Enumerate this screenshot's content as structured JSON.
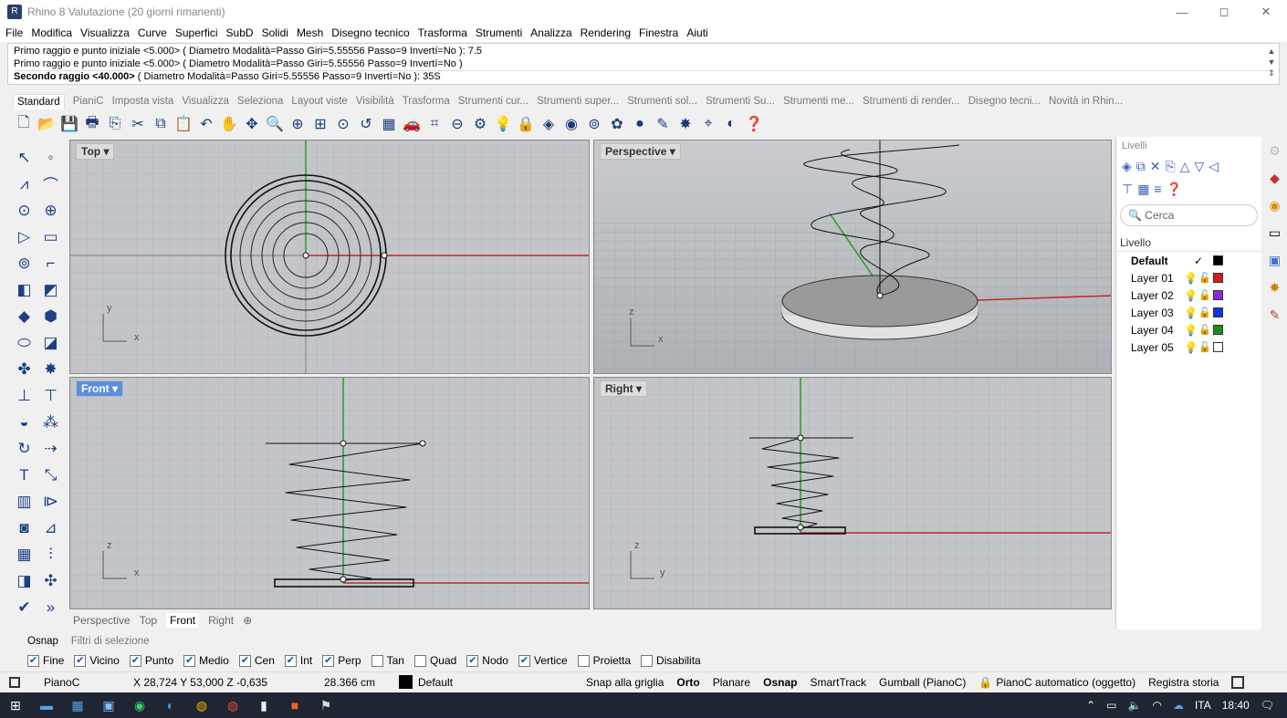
{
  "window": {
    "title": "Rhino 8 Valutazione (20 giorni rimanenti)",
    "min": "—",
    "max": "◻",
    "close": "✕"
  },
  "menu": [
    "File",
    "Modifica",
    "Visualizza",
    "Curve",
    "Superfici",
    "SubD",
    "Solidi",
    "Mesh",
    "Disegno tecnico",
    "Trasforma",
    "Strumenti",
    "Analizza",
    "Rendering",
    "Finestra",
    "Aiuti"
  ],
  "command_history": {
    "line1": "Primo raggio e punto iniziale <5.000> ( Diametro  Modalità=Passo  Giri=5.55556  Passo=9  Invertí=No ): 7.5",
    "line2": "Primo raggio e punto iniziale <5.000> ( Diametro  Modalità=Passo  Giri=5.55556  Passo=9  Invertí=No )",
    "line3_bold": "Secondo raggio <40.000>",
    "line3_rest": " ( Diametro  Modalità=Passo  Giri=5.55556  Passo=9  Invertí=No ): 35S"
  },
  "toolbar_tabs": [
    "Standard",
    "PianiC",
    "Imposta vista",
    "Visualizza",
    "Seleziona",
    "Layout viste",
    "Visibilità",
    "Trasforma",
    "Strumenti cur...",
    "Strumenti super...",
    "Strumenti sol...",
    "Strumenti Su...",
    "Strumenti me...",
    "Strumenti di render...",
    "Disegno tecni...",
    "Novità in Rhin..."
  ],
  "viewports": {
    "top": "Top",
    "perspective": "Perspective",
    "front": "Front",
    "right": "Right"
  },
  "axis_labels": {
    "x": "x",
    "y": "y",
    "z": "z"
  },
  "viewport_tabs": [
    "Perspective",
    "Top",
    "Front",
    "Right",
    "⊕"
  ],
  "layers_panel": {
    "title": "Livelli",
    "search_placeholder": "Cerca",
    "column": "Livello",
    "layers": [
      {
        "name": "Default",
        "current": true,
        "color": "#000000"
      },
      {
        "name": "Layer 01",
        "color": "#d81b1b"
      },
      {
        "name": "Layer 02",
        "color": "#8a2be2"
      },
      {
        "name": "Layer 03",
        "color": "#1432e6"
      },
      {
        "name": "Layer 04",
        "color": "#1a8f1a"
      },
      {
        "name": "Layer 05",
        "color": "#ffffff"
      }
    ],
    "check": "✓"
  },
  "osnap": {
    "tabs": [
      "Osnap",
      "Filtri di selezione"
    ],
    "items": [
      {
        "label": "Fine",
        "checked": true
      },
      {
        "label": "Vicino",
        "checked": true
      },
      {
        "label": "Punto",
        "checked": true
      },
      {
        "label": "Medio",
        "checked": true
      },
      {
        "label": "Cen",
        "checked": true
      },
      {
        "label": "Int",
        "checked": true
      },
      {
        "label": "Perp",
        "checked": true
      },
      {
        "label": "Tan",
        "checked": false
      },
      {
        "label": "Quad",
        "checked": false
      },
      {
        "label": "Nodo",
        "checked": true
      },
      {
        "label": "Vertice",
        "checked": true
      },
      {
        "label": "Proietta",
        "checked": false
      },
      {
        "label": "Disabilita",
        "checked": false
      }
    ]
  },
  "status": {
    "cplane": "PianoC",
    "coords": "X 28,724 Y 53,000 Z -0,635",
    "dist": "28.366 cm",
    "layer": "Default",
    "snap": "Snap alla griglia",
    "orto": "Orto",
    "planare": "Planare",
    "osnap": "Osnap",
    "smarttrack": "SmartTrack",
    "gumball": "Gumball (PianoC)",
    "autocplane": "PianoC automatico (oggetto)",
    "history": "Registra storia"
  },
  "tray": {
    "lang": "ITA",
    "time": "18:40"
  }
}
